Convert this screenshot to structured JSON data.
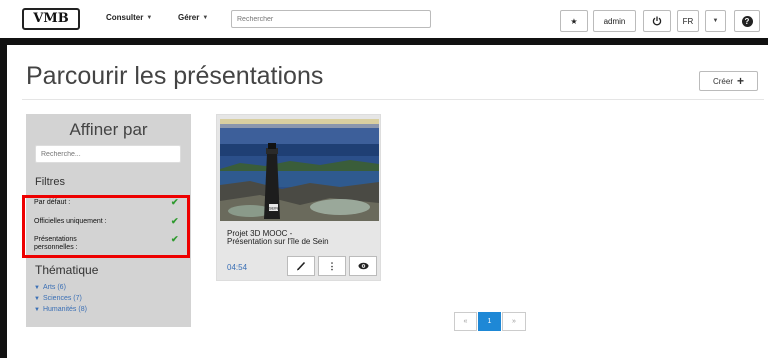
{
  "navbar": {
    "logo": "VMB",
    "menu_consult": "Consulter",
    "menu_manage": "Gérer",
    "search_placeholder": "Rechercher",
    "user": "admin",
    "language": "FR"
  },
  "page": {
    "title": "Parcourir les présentations",
    "create_label": "Créer"
  },
  "sidebar": {
    "title": "Affiner par",
    "search_placeholder": "Recherche...",
    "filters_heading": "Filtres",
    "filters": [
      {
        "label": "Par défaut :",
        "checked": true
      },
      {
        "label": "Officielles uniquement :",
        "checked": true
      },
      {
        "label_line1": "Présentations",
        "label_line2": "personnelles :",
        "checked": true
      }
    ],
    "topics_heading": "Thématique",
    "topics": [
      "Arts (6)",
      "Sciences (7)",
      "Humanités (8)"
    ]
  },
  "card": {
    "title_line1": "Projet 3D MOOC -",
    "title_line2": "Présentation sur l'île de Sein",
    "duration": "04:54",
    "lighthouse_text": "SEIN"
  },
  "pagination": {
    "prev": "«",
    "current": "1",
    "next": "»"
  },
  "colors": {
    "accent": "#1e88d6",
    "check": "#2e9a2e",
    "highlight": "#e00000"
  }
}
